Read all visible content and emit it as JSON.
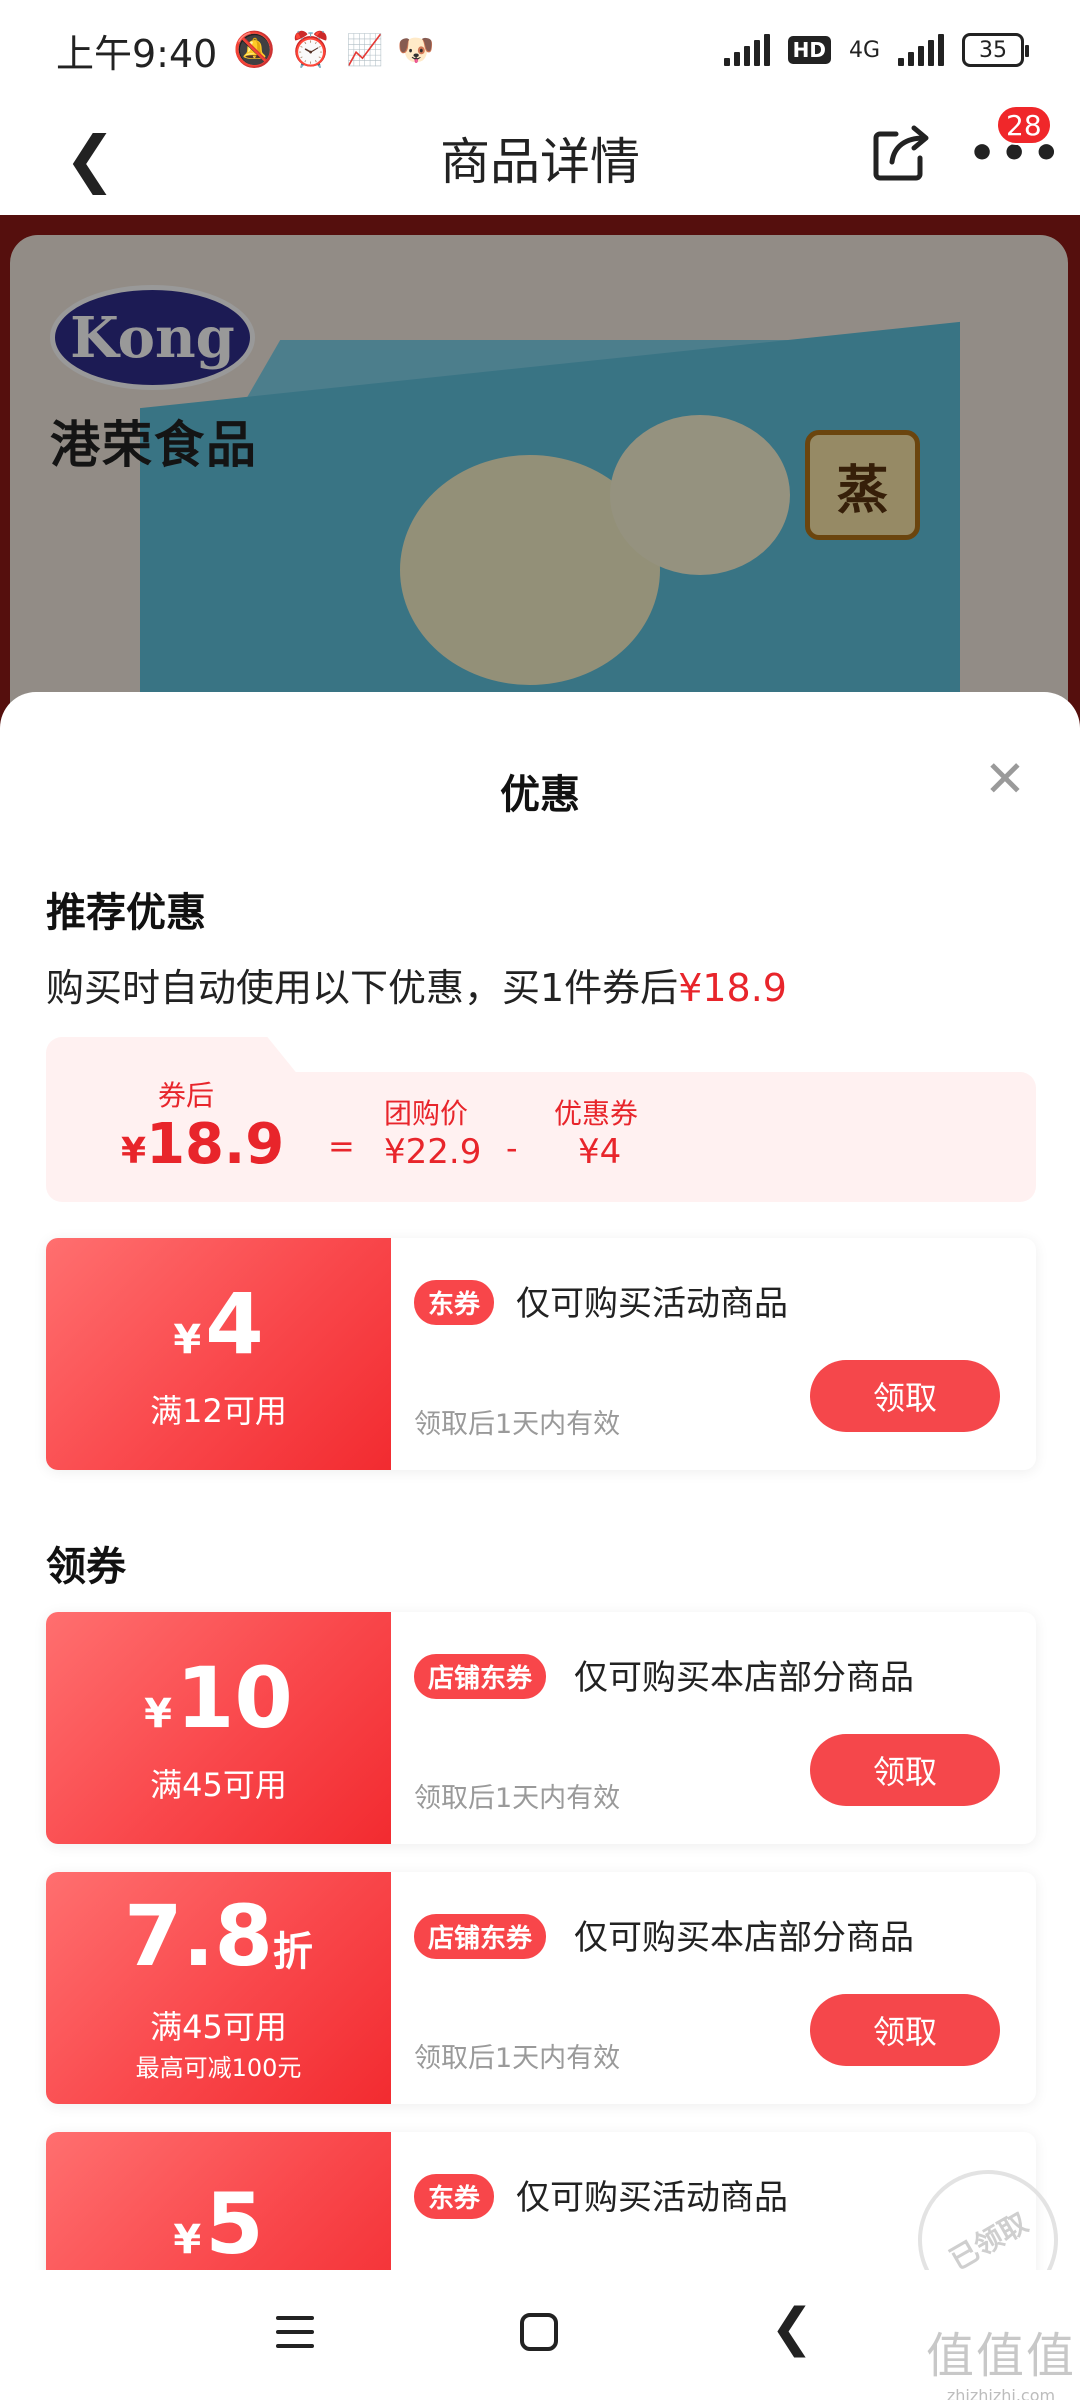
{
  "status_bar": {
    "time": "上午9:40",
    "network": "4G",
    "battery": "35"
  },
  "nav": {
    "title": "商品详情",
    "badge_count": "28"
  },
  "product": {
    "brand_logo": "Kong",
    "brand_name": "港荣食品",
    "box_badge": "蒸"
  },
  "sheet": {
    "title": "优惠",
    "recommend": {
      "title": "推荐优惠",
      "desc_prefix": "购买时自动使用以下优惠，买1件券后",
      "desc_price": "¥18.9",
      "calc": {
        "after_label": "券后",
        "after_yen": "¥",
        "after_value": "18.9",
        "equals": "=",
        "group_label": "团购价",
        "group_value": "¥22.9",
        "minus": "-",
        "coupon_label": "优惠券",
        "coupon_value": "¥4"
      }
    },
    "coupons_top": [
      {
        "yen": "¥",
        "amount": "4",
        "condition": "满12可用",
        "tag": "东券",
        "desc": "仅可购买活动商品",
        "validity": "领取后1天内有效",
        "button": "领取"
      }
    ],
    "get_coupons": {
      "title": "领券",
      "items": [
        {
          "yen": "¥",
          "amount": "10",
          "condition": "满45可用",
          "tag": "店铺东券",
          "desc": "仅可购买本店部分商品",
          "validity": "领取后1天内有效",
          "button": "领取"
        },
        {
          "amount": "7.8",
          "unit": "折",
          "condition": "满45可用",
          "max_note": "最高可减100元",
          "tag": "店铺东券",
          "desc": "仅可购买本店部分商品",
          "validity": "领取后1天内有效",
          "button": "领取"
        },
        {
          "yen": "¥",
          "amount": "5",
          "tag": "东券",
          "desc": "仅可购买活动商品",
          "stamp": "已领取"
        }
      ]
    }
  },
  "watermark": {
    "text": "值值值",
    "domain": "zhizhizhi.com"
  }
}
